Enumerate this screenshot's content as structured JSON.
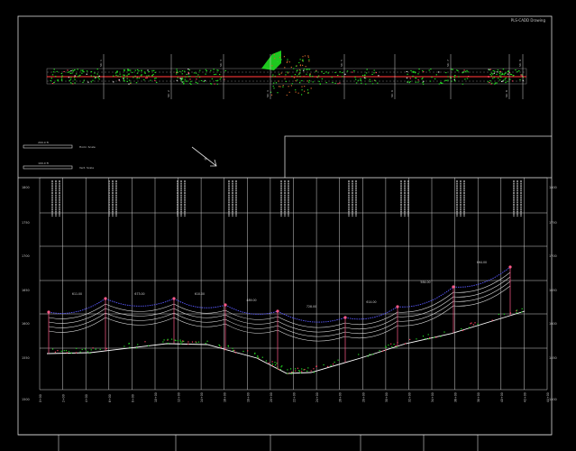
{
  "drawing": {
    "title": "PLS-CADD Drawing",
    "colors": {
      "background": "#000000",
      "frame": "#d8d8d8",
      "grid": "#cfcfcf",
      "ground": "#ffffff",
      "vegetation": "#22dd22",
      "conductor_top": "#5a5aff",
      "conductors": "#e0e0e0",
      "structures": "#ff5a8a",
      "alignment": "#e03030"
    }
  },
  "scales": {
    "horizontal": {
      "bar_label": "200.0 ft",
      "caption": "Horiz. Scale"
    },
    "vertical": {
      "bar_label": "100.0 ft",
      "caption": "Vert. Scale"
    }
  },
  "north_arrow": {
    "label": "N"
  },
  "profile": {
    "elevation_labels": [
      "1800",
      "1750",
      "1700",
      "1650",
      "1600",
      "1550",
      "1500"
    ],
    "station_labels": [
      "0+00",
      "2+00",
      "4+00",
      "6+00",
      "8+00",
      "10+00",
      "12+00",
      "14+00",
      "16+00",
      "18+00",
      "20+00",
      "22+00",
      "24+00",
      "26+00",
      "28+00",
      "30+00",
      "32+00",
      "34+00",
      "36+00",
      "38+00",
      "40+00",
      "42+00",
      "44+00"
    ],
    "span_labels": [
      "611.00",
      "673.00",
      "610.00",
      "489.00",
      "728.00",
      "614.00",
      "584.00",
      "664.00"
    ]
  },
  "plan": {
    "structure_tags": [
      "Str. 1",
      "Str. 2",
      "Str. 3",
      "Str. 4",
      "Str. 5",
      "Str. 6",
      "Str. 7",
      "Str. 8",
      "Str. 9"
    ]
  },
  "title_block": {
    "cells": [
      "",
      "",
      "",
      "",
      "",
      "",
      ""
    ]
  }
}
